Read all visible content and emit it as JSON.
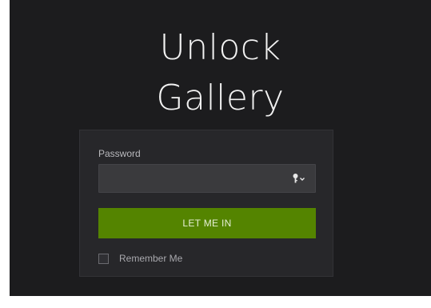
{
  "title": {
    "line1": "Unlock",
    "line2": "Gallery"
  },
  "form": {
    "password_label": "Password",
    "password_value": "",
    "password_placeholder": "",
    "key_icon": "key-icon",
    "submit_label": "LET ME IN",
    "remember_label": "Remember Me",
    "remember_checked": false
  },
  "colors": {
    "background": "#1c1c1e",
    "panel": "#27272a",
    "input": "#3a3a3d",
    "button": "#548400",
    "title_text": "#f2f2f2"
  }
}
